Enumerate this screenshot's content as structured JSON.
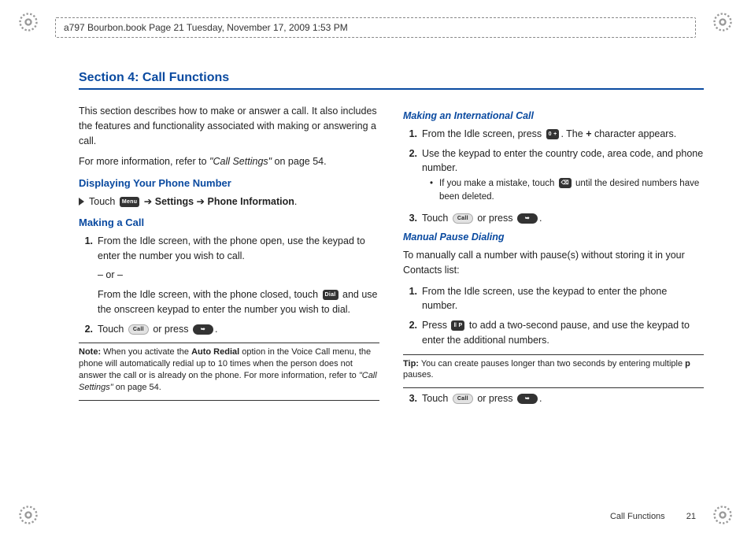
{
  "header": {
    "text": "a797 Bourbon.book  Page 21  Tuesday, November 17, 2009  1:53 PM"
  },
  "section_title": "Section 4: Call Functions",
  "left": {
    "intro1": "This section describes how to make or answer a call. It also includes the features and functionality associated with making or answering a call.",
    "intro2_pre": "For more information, refer to ",
    "intro2_ref": "\"Call Settings\"",
    "intro2_post": "  on page 54.",
    "h_display": "Displaying Your Phone Number",
    "display_touch": "Touch ",
    "display_arrow1": " ➔ ",
    "display_settings": "Settings",
    "display_arrow2": " ➔ ",
    "display_phoneinfo": "Phone Information",
    "display_period": ".",
    "h_making": "Making a Call",
    "step1": "From the Idle screen, with the phone open, use the keypad to enter the number you wish to call.",
    "or": "– or –",
    "step1b_a": "From the Idle screen, with the phone closed, touch ",
    "step1b_b": " and use the onscreen keypad to enter the number you wish to dial.",
    "step2_a": "Touch ",
    "step2_b": " or press ",
    "step2_c": ".",
    "note_lbl": "Note:",
    "note_a": " When you activate the ",
    "note_b": "Auto Redial",
    "note_c": " option in the Voice Call menu, the phone will automatically redial up to 10 times when the person does not answer the call or is already on the phone. For more information, refer to ",
    "note_ref": "\"Call Settings\"",
    "note_d": "  on page 54."
  },
  "right": {
    "h_intl": "Making an International Call",
    "i1_a": "From the Idle screen, press ",
    "i1_b": ". The ",
    "i1_plus": "+",
    "i1_c": " character appears.",
    "i2": "Use the keypad to enter the country code, area code, and phone number.",
    "i2_bullet_a": "If you make a mistake, touch ",
    "i2_bullet_b": " until the desired numbers have been deleted.",
    "i3_a": "Touch ",
    "i3_b": " or press ",
    "i3_c": ".",
    "h_pause": "Manual Pause Dialing",
    "pause_intro": "To manually call a number with pause(s) without storing it in your Contacts list:",
    "p1": "From the Idle screen, use the keypad to enter the phone number.",
    "p2_a": "Press ",
    "p2_b": " to add a two-second pause, and use the keypad to enter the additional numbers.",
    "tip_lbl": "Tip:",
    "tip_a": " You can create pauses longer than two seconds by entering multiple ",
    "tip_b": "p",
    "tip_c": " pauses.",
    "p3_a": "Touch ",
    "p3_b": " or press ",
    "p3_c": "."
  },
  "icons": {
    "menu": "Menu",
    "dial": "Dial",
    "call": "Call",
    "send": "➥",
    "zero": "0 +",
    "del": "⌫",
    "pause": "‖ P"
  },
  "footer": {
    "label": "Call Functions",
    "page": "21"
  }
}
